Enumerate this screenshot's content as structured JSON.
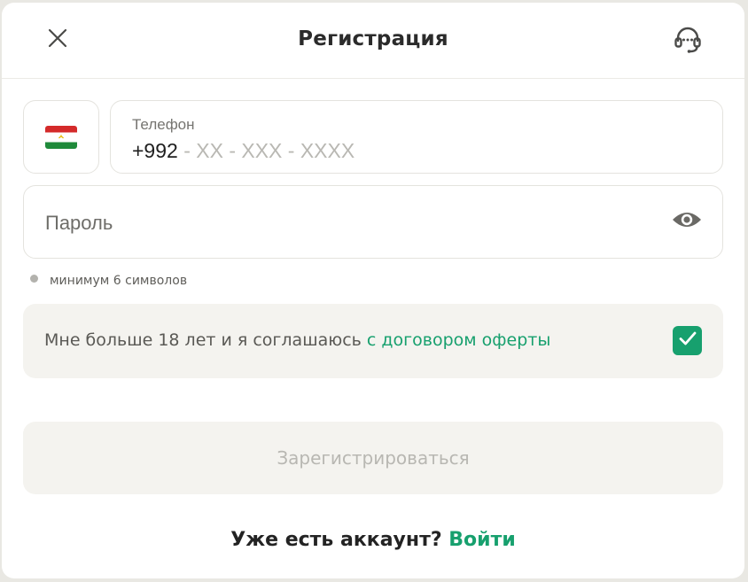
{
  "header": {
    "title": "Регистрация",
    "close_icon": "close-icon",
    "support_icon": "headset-icon"
  },
  "phone": {
    "country_flag": "tajikistan-flag",
    "label": "Телефон",
    "prefix": "+992",
    "mask": " - XX - XXX - XXXX"
  },
  "password": {
    "placeholder": "Пароль",
    "toggle_icon": "eye-icon"
  },
  "hint": {
    "text": "минимум 6 символов"
  },
  "agreement": {
    "text": "Мне больше 18 лет и я соглашаюсь ",
    "link": "с договором оферты",
    "checked": true
  },
  "register": {
    "label": "Зарегистрироваться",
    "enabled": false
  },
  "login": {
    "question": "Уже есть аккаунт?",
    "link": "Войти"
  },
  "colors": {
    "accent": "#17a06e",
    "text": "#232323",
    "muted": "#b8b7b2",
    "surface": "#f4f3ef",
    "border": "#e4e3de"
  }
}
